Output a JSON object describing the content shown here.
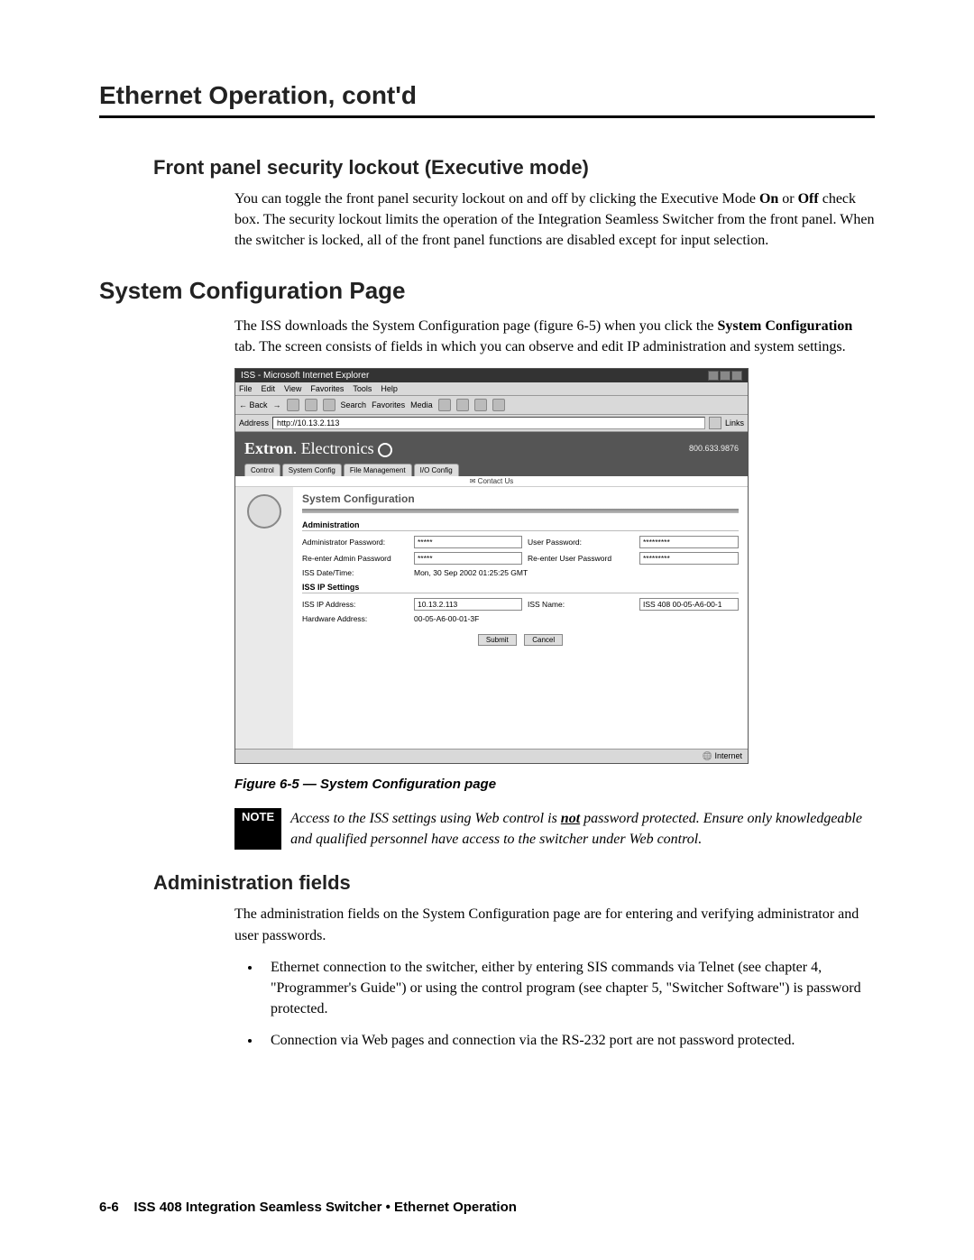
{
  "chapter_title": "Ethernet Operation, cont'd",
  "section1": {
    "heading": "Front panel security lockout (Executive mode)",
    "p1_pre": "You can toggle the front panel security lockout on and off by clicking the Executive Mode ",
    "p1_on": "On",
    "p1_mid": " or ",
    "p1_off": "Off",
    "p1_post": " check box.  The security lockout limits the operation of the Integration Seamless Switcher from the front panel.  When the switcher is locked, all of the front panel functions are disabled except for input selection."
  },
  "section2": {
    "heading": "System Configuration Page",
    "p1_pre": "The ISS downloads the System Configuration page (figure 6-5) when you click the ",
    "p1_bold": "System Configuration",
    "p1_post": " tab.  The screen consists of fields in which you can observe and edit IP administration and system settings."
  },
  "figure": {
    "caption": "Figure 6-5 — System Configuration page",
    "ie": {
      "title": "ISS - Microsoft Internet Explorer",
      "menu": [
        "File",
        "Edit",
        "View",
        "Favorites",
        "Tools",
        "Help"
      ],
      "toolbar": {
        "back": "Back",
        "search": "Search",
        "favorites": "Favorites",
        "media": "Media"
      },
      "address_label": "Address",
      "address_value": "http://10.13.2.113",
      "links": "Links",
      "status_left": "",
      "status_right": "Internet"
    },
    "extron": {
      "logo1": "Extron",
      "logo2": "Electronics",
      "phone": "800.633.9876",
      "tabs": [
        "Control",
        "System Config",
        "File Management",
        "I/O Config"
      ],
      "contact": "Contact Us",
      "page_title": "System Configuration",
      "admin_h": "Administration",
      "admin_pw_label": "Administrator Password:",
      "admin_pw_val": "*****",
      "user_pw_label": "User Password:",
      "user_pw_val": "*********",
      "re_admin_label": "Re-enter Admin Password",
      "re_admin_val": "*****",
      "re_user_label": "Re-enter User Password",
      "re_user_val": "*********",
      "datetime_label": "ISS Date/Time:",
      "datetime_val": "Mon, 30 Sep 2002 01:25:25 GMT",
      "ip_h": "ISS IP Settings",
      "ip_label": "ISS IP Address:",
      "ip_val": "10.13.2.113",
      "name_label": "ISS Name:",
      "name_val": "ISS 408 00-05-A6-00-1",
      "hw_label": "Hardware Address:",
      "hw_val": "00-05-A6-00-01-3F",
      "submit": "Submit",
      "cancel": "Cancel"
    }
  },
  "note": {
    "badge": "NOTE",
    "t1": "Access to the ISS settings using Web control is ",
    "not": "not",
    "t2": " password protected.  Ensure only knowledgeable and qualified personnel have access to the switcher under Web control."
  },
  "section3": {
    "heading": "Administration fields",
    "p1": "The administration fields on the System Configuration page are for entering and verifying administrator and user passwords.",
    "b1": "Ethernet connection to the switcher, either by entering SIS commands via Telnet (see chapter 4, \"Programmer's Guide\") or using the control program (see chapter 5, \"Switcher Software\") is password protected.",
    "b2": "Connection via Web pages and connection via the RS-232 port are not password protected."
  },
  "footer": {
    "page_num": "6-6",
    "text": "ISS 408 Integration Seamless Switcher • Ethernet Operation"
  }
}
